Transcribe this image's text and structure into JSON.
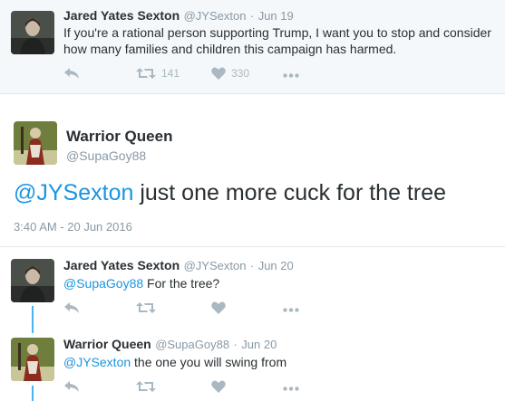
{
  "tweet1": {
    "name": "Jared Yates Sexton",
    "handle": "@JYSexton",
    "date": "Jun 19",
    "text": "If you're a rational person supporting Trump, I want you to stop and consider how many families and children this campaign has harmed.",
    "retweets": "141",
    "likes": "330"
  },
  "main": {
    "name": "Warrior Queen",
    "handle": "@SupaGoy88",
    "mention": "@JYSexton",
    "text": " just one more cuck for the tree",
    "timestamp": "3:40 AM - 20 Jun 2016"
  },
  "reply1": {
    "name": "Jared Yates Sexton",
    "handle": "@JYSexton",
    "date": "Jun 20",
    "mention": "@SupaGoy88",
    "text": " For the tree?"
  },
  "reply2": {
    "name": "Warrior Queen",
    "handle": "@SupaGoy88",
    "date": "Jun 20",
    "mention": "@JYSexton",
    "text": " the one you will swing from"
  },
  "colors": {
    "link": "#1b95e0",
    "icon": "#aab8c2",
    "thread": "#4ab3f4"
  }
}
